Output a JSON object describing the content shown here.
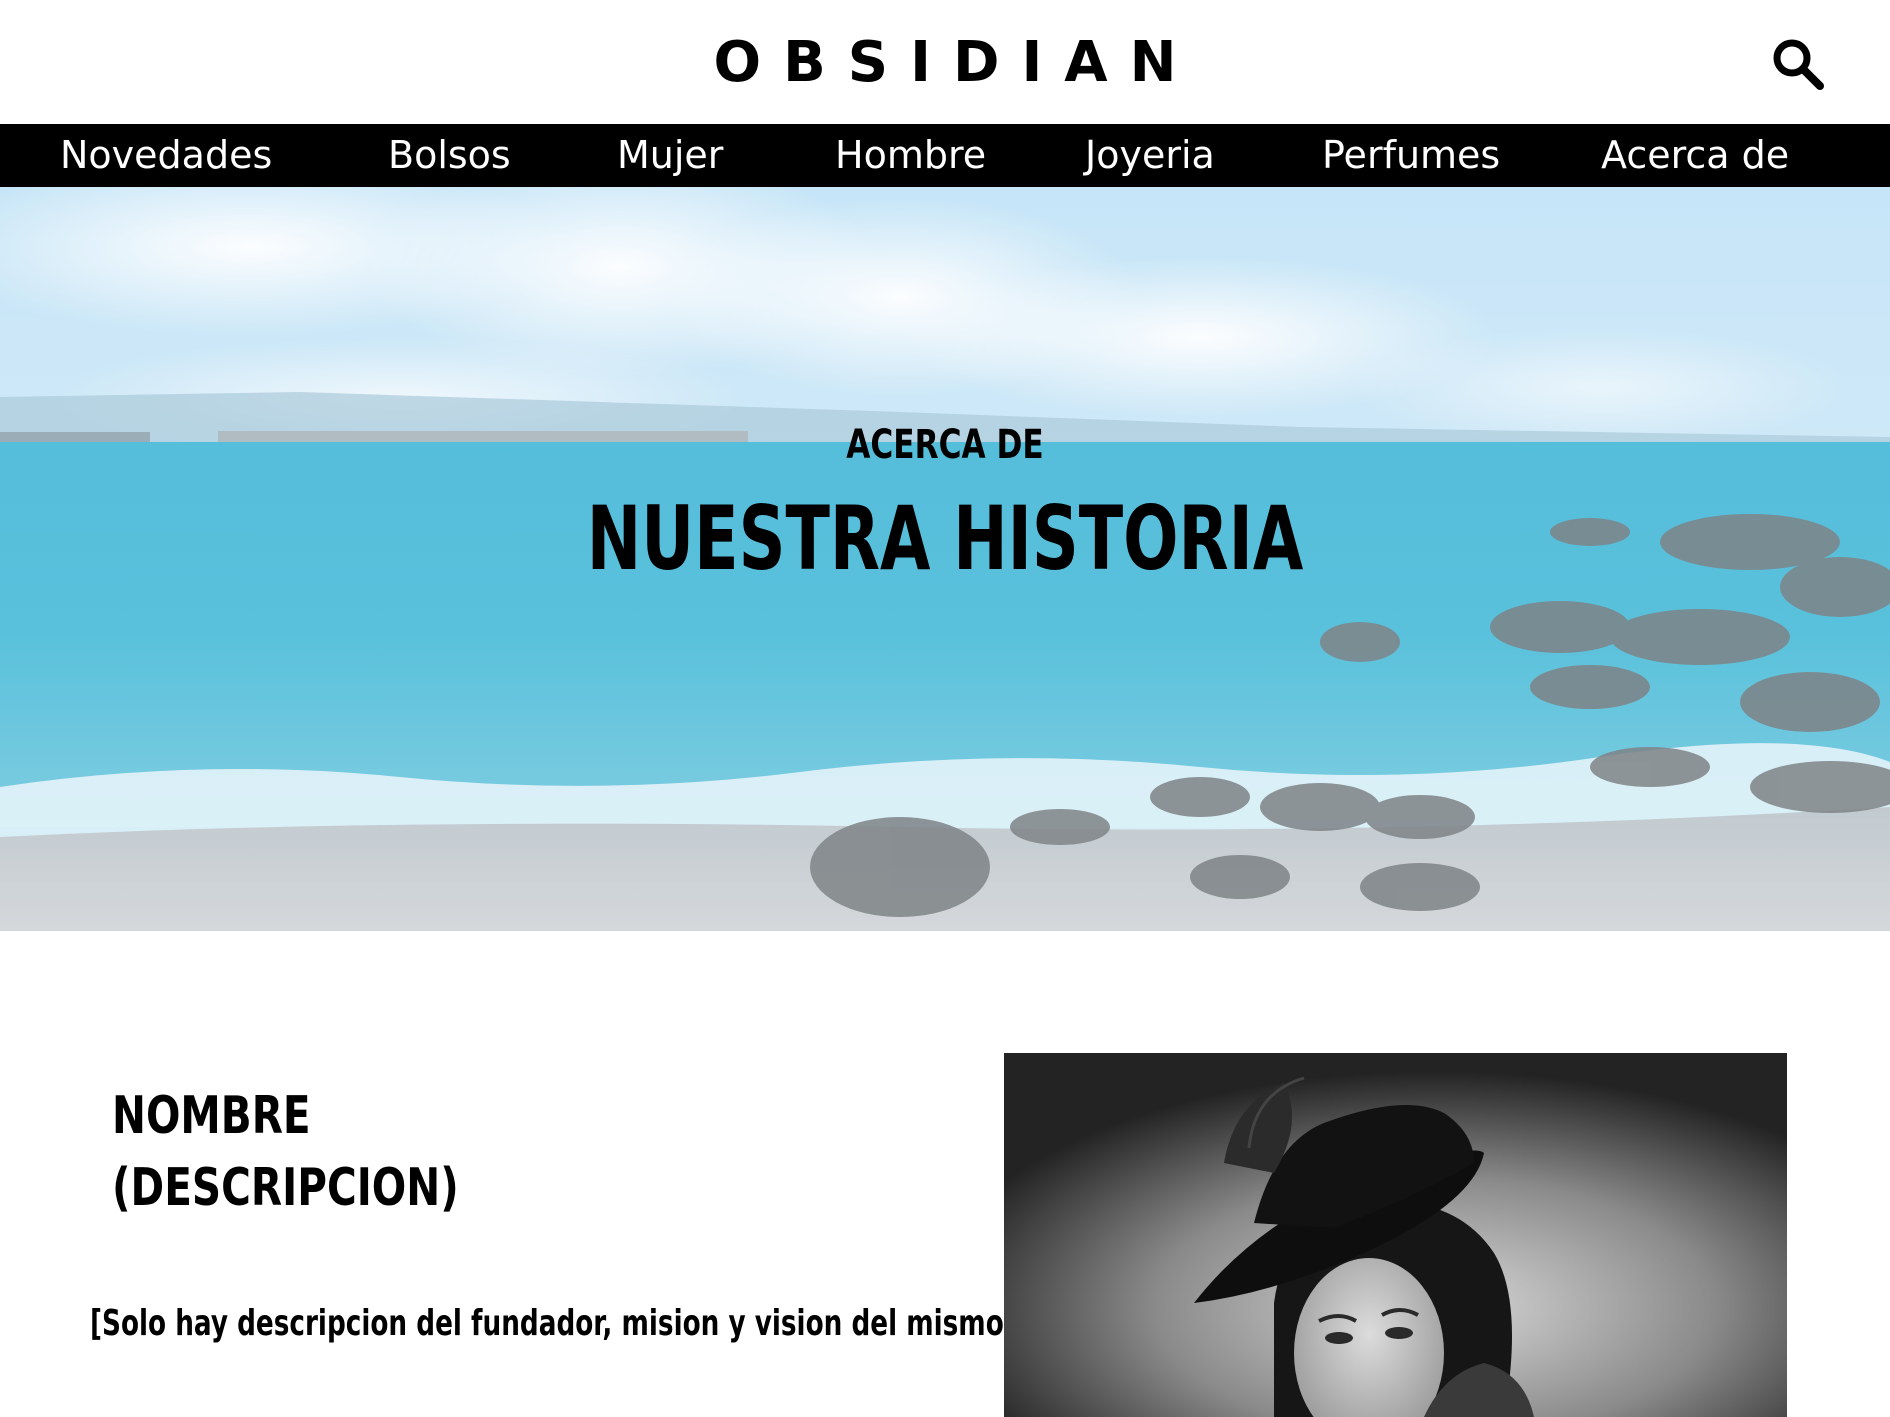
{
  "header": {
    "logo": "OBSIDIAN",
    "search_icon": "search-icon"
  },
  "nav": {
    "items": [
      {
        "label": "Novedades"
      },
      {
        "label": "Bolsos"
      },
      {
        "label": "Mujer"
      },
      {
        "label": "Hombre"
      },
      {
        "label": "Joyeria"
      },
      {
        "label": "Perfumes"
      },
      {
        "label": "Acerca de"
      }
    ]
  },
  "hero": {
    "subtitle": "ACERCA DE",
    "title": "NUESTRA HISTORIA"
  },
  "founder": {
    "name_line1": "NOMBRE",
    "name_line2": "(DESCRIPCION)",
    "description": "[Solo hay descripcion del fundador, mision y vision del mismo]"
  },
  "colors": {
    "nav_background": "#000000",
    "nav_text": "#ffffff",
    "text": "#000000"
  }
}
